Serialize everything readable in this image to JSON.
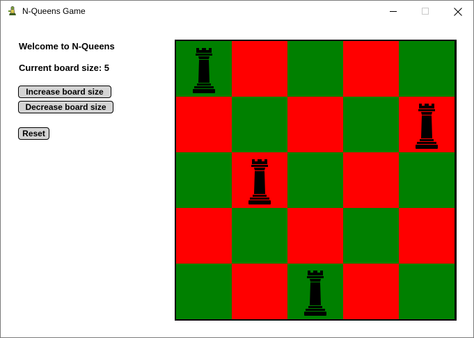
{
  "window": {
    "title": "N-Queens Game"
  },
  "side": {
    "welcome": "Welcome to N-Queens",
    "size_line": "Current board size: 5",
    "increase_label": "Increase board size",
    "decrease_label": "Decrease board size",
    "reset_label": "Reset"
  },
  "board": {
    "size": 5,
    "queens": [
      {
        "row": 0,
        "col": 0
      },
      {
        "row": 1,
        "col": 4
      },
      {
        "row": 2,
        "col": 1
      },
      {
        "row": 4,
        "col": 2
      }
    ],
    "colors": {
      "light": "#008000",
      "dark": "#ff0000"
    },
    "piece_icon": "chess-queen-icon"
  }
}
